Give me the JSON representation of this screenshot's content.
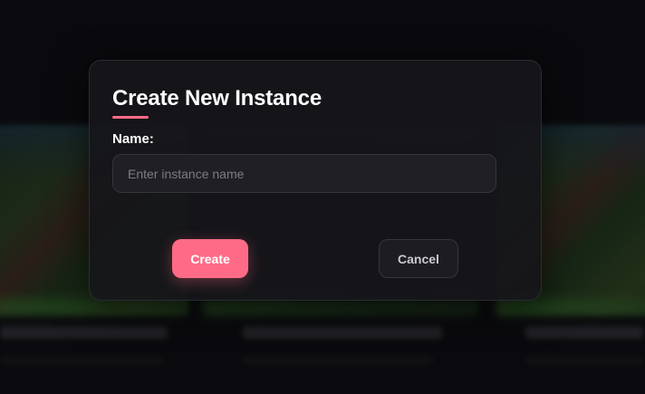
{
  "modal": {
    "title": "Create New Instance",
    "name_label": "Name:",
    "name_input": {
      "value": "",
      "placeholder": "Enter instance name"
    },
    "create_label": "Create",
    "cancel_label": "Cancel"
  },
  "colors": {
    "accent": "#ff6b87",
    "modal_background": "#16161a",
    "input_background": "#202024",
    "page_background": "#0c0c0f"
  }
}
